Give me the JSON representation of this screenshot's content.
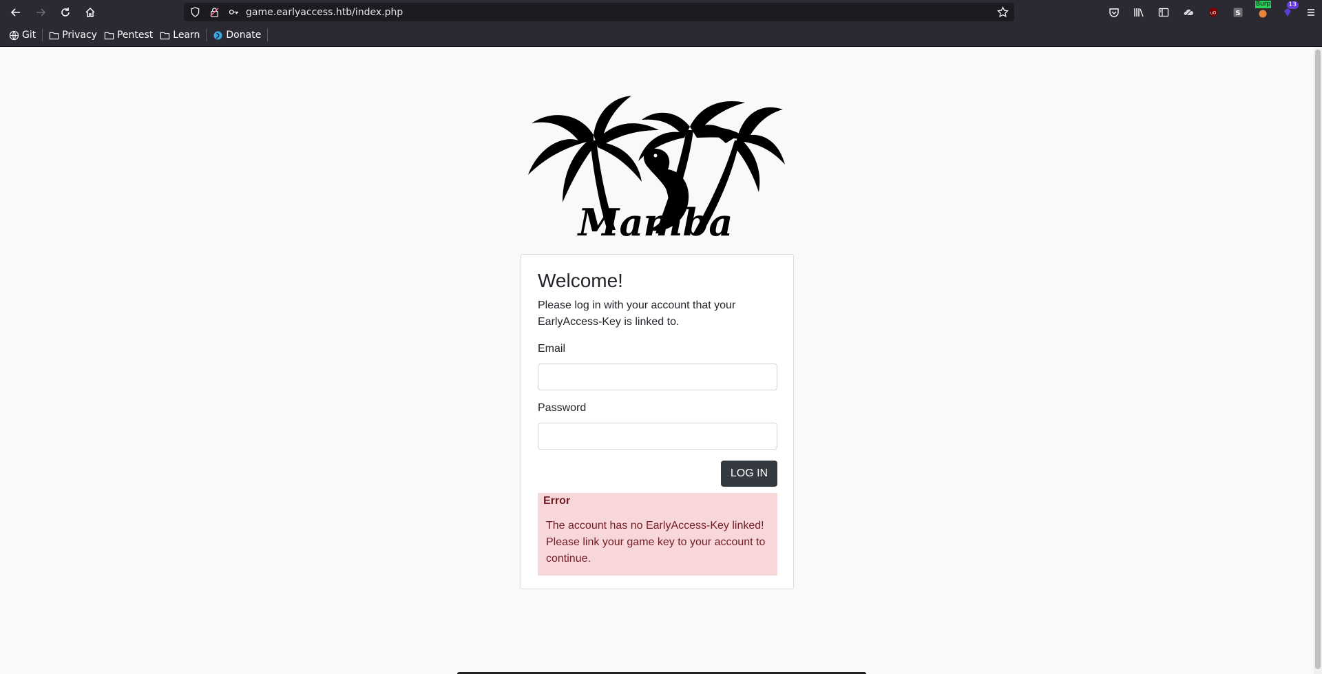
{
  "browser": {
    "url": "game.earlyaccess.htb/index.php",
    "bookmarks": [
      {
        "label": "Git",
        "icon": "globe-icon"
      },
      {
        "label": "Privacy",
        "icon": "folder-icon"
      },
      {
        "label": "Pentest",
        "icon": "folder-icon"
      },
      {
        "label": "Learn",
        "icon": "folder-icon"
      },
      {
        "label": "Donate",
        "icon": "donate-icon"
      }
    ],
    "extensions": {
      "burp_label": "Burp",
      "notification_count": "13"
    }
  },
  "logo": {
    "text": "Mamba"
  },
  "login": {
    "title": "Welcome!",
    "intro": "Please log in with your account that your EarlyAccess-Key is linked to.",
    "email_label": "Email",
    "email_value": "",
    "password_label": "Password",
    "password_value": "",
    "submit_label": "LOG IN"
  },
  "error": {
    "title": "Error",
    "message": "The account has no EarlyAccess-Key linked! Please link your game key to your account to continue."
  },
  "colors": {
    "toolbar_bg": "#2b2a33",
    "page_bg": "#f8f9fa",
    "button_bg": "#343a40",
    "alert_bg": "#f8d7da",
    "alert_text": "#721c24"
  }
}
